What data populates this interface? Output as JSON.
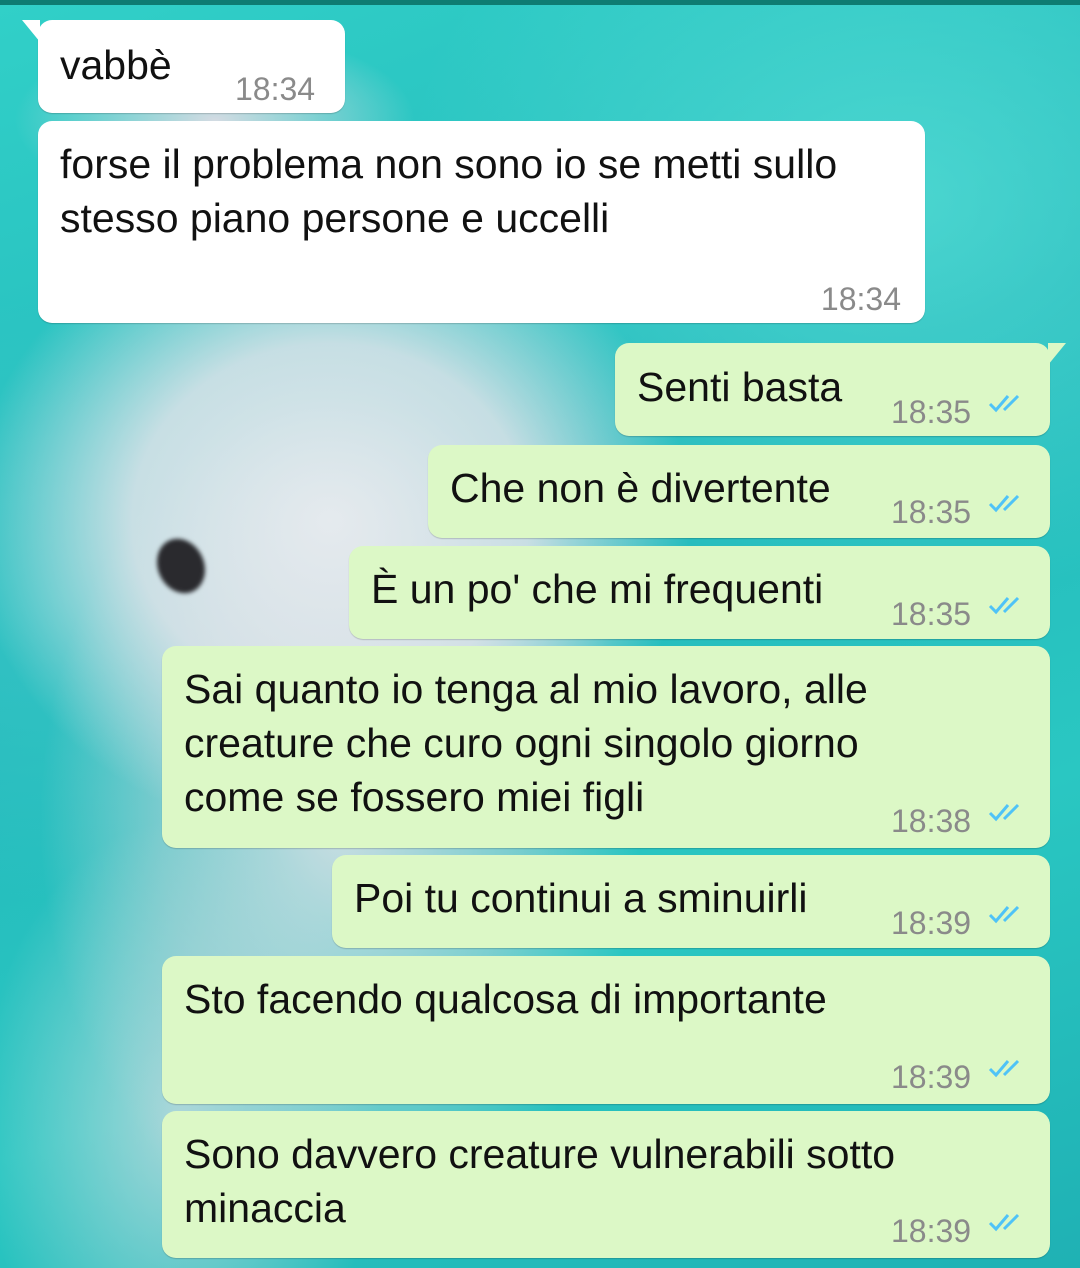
{
  "conversation": {
    "tick_color": "#4fc3f7",
    "wallpaper": "dolphin-underwater",
    "messages": [
      {
        "text": "vabbè",
        "time": "18:34",
        "direction": "incoming"
      },
      {
        "text": "forse il problema non sono io se metti sullo stesso piano persone e uccelli",
        "time": "18:34",
        "direction": "incoming"
      },
      {
        "text": "Senti basta",
        "time": "18:35",
        "direction": "outgoing",
        "status": "read"
      },
      {
        "text": "Che non è divertente",
        "time": "18:35",
        "direction": "outgoing",
        "status": "read"
      },
      {
        "text": "È un po' che mi frequenti",
        "time": "18:35",
        "direction": "outgoing",
        "status": "read"
      },
      {
        "text": "Sai quanto io tenga al mio lavoro, alle creature che curo ogni singolo giorno come se fossero miei figli",
        "time": "18:38",
        "direction": "outgoing",
        "status": "read"
      },
      {
        "text": "Poi tu continui a sminuirli",
        "time": "18:39",
        "direction": "outgoing",
        "status": "read"
      },
      {
        "text": "Sto facendo qualcosa di importante",
        "time": "18:39",
        "direction": "outgoing",
        "status": "read"
      },
      {
        "text": "Sono davvero creature vulnerabili sotto minaccia",
        "time": "18:39",
        "direction": "outgoing",
        "status": "read"
      }
    ]
  }
}
